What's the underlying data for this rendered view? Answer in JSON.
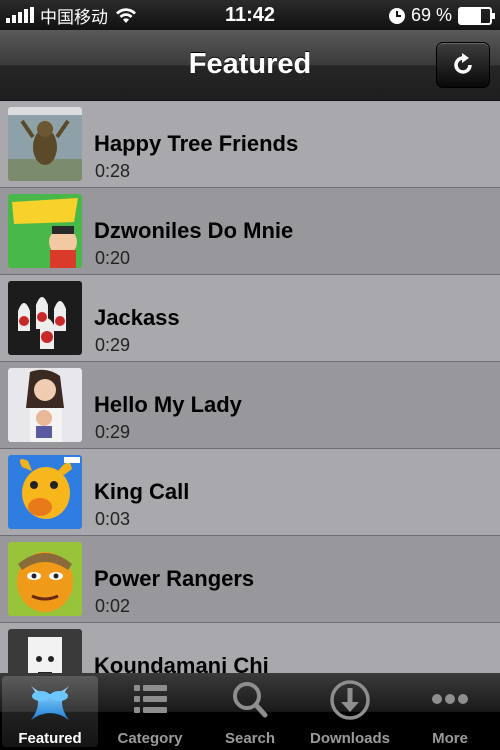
{
  "status_bar": {
    "carrier": "中国移动",
    "time": "11:42",
    "battery_percent": "69 %",
    "battery_level": 0.69,
    "icons": [
      "signal-icon",
      "wifi-icon",
      "clock-icon",
      "battery-icon"
    ]
  },
  "nav": {
    "title": "Featured",
    "refresh_icon": "refresh-icon"
  },
  "videos": [
    {
      "title": "Happy Tree Friends",
      "duration": "0:28"
    },
    {
      "title": "Dzwoniles Do Mnie",
      "duration": "0:20"
    },
    {
      "title": "Jackass",
      "duration": "0:29"
    },
    {
      "title": "Hello My Lady",
      "duration": "0:29"
    },
    {
      "title": "King Call",
      "duration": "0:03"
    },
    {
      "title": "Power Rangers",
      "duration": "0:02"
    },
    {
      "title": "Koundamani Chi",
      "duration": ""
    }
  ],
  "tabs": [
    {
      "label": "Featured",
      "icon": "featured-icon",
      "active": true
    },
    {
      "label": "Category",
      "icon": "category-list-icon",
      "active": false
    },
    {
      "label": "Search",
      "icon": "search-icon",
      "active": false
    },
    {
      "label": "Downloads",
      "icon": "download-icon",
      "active": false
    },
    {
      "label": "More",
      "icon": "more-dots-icon",
      "active": false
    }
  ],
  "colors": {
    "row_light": "#a9a8ad",
    "row_dark": "#98979c",
    "accent_blue": "#3fa9f5"
  }
}
